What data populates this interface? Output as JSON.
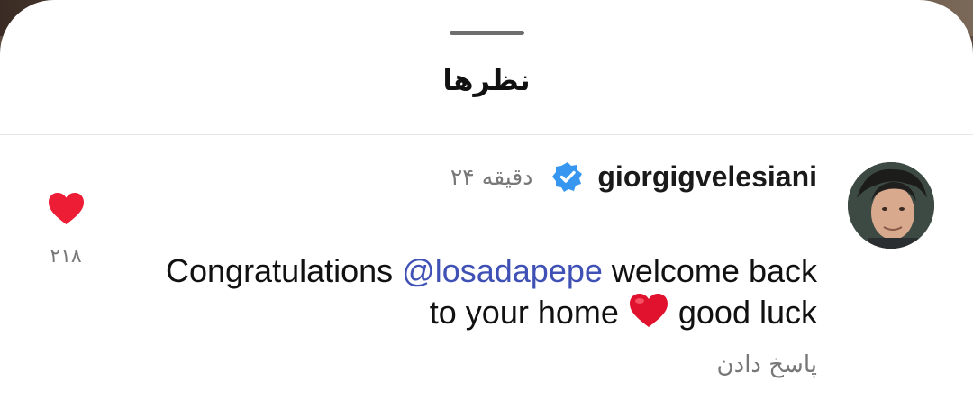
{
  "sheet": {
    "title": "نظرها"
  },
  "comment": {
    "username": "giorgigvelesiani",
    "verified": true,
    "timestamp": "۲۴ دقیقه",
    "text_before": "Congratulations ",
    "mention": "@losadapepe",
    "text_middle": "  welcome back to your home ",
    "emoji": "red-heart",
    "text_after": " good luck",
    "reply_label": "پاسخ دادن",
    "liked": true,
    "like_count": "۲۱۸"
  },
  "colors": {
    "mention": "#3f51b5",
    "verified_badge": "#3797f0",
    "heart": "#ee1d36",
    "muted_text": "#777777"
  }
}
